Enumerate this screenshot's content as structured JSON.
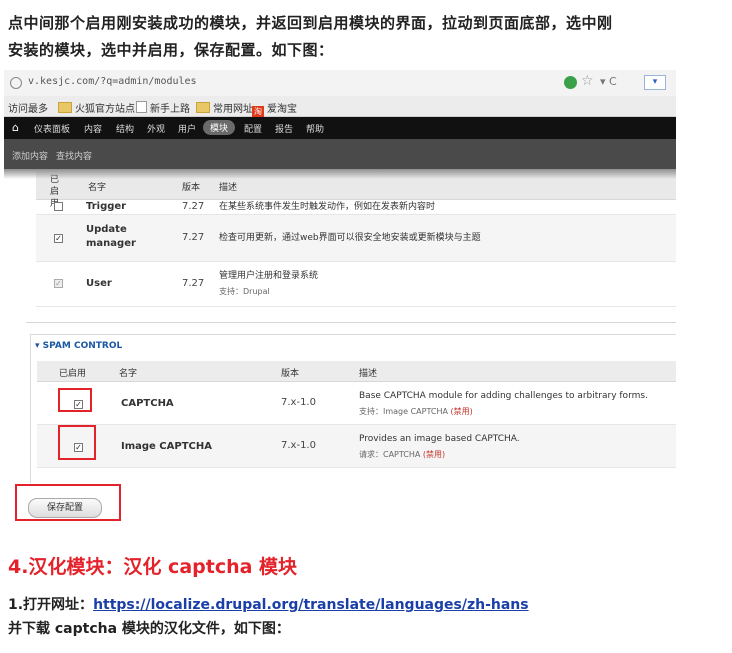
{
  "intro": {
    "line1": "点中间那个启用刚安装成功的模块，并返回到启用模块的界面，拉动到页面底部，选中刚",
    "line2": "安装的模块，选中并启用，保存配置。如下图："
  },
  "browser": {
    "url": "v.kesjc.com/?q=admin/modules",
    "bookmarks": [
      "访问最多",
      "火狐官方站点",
      "新手上路",
      "常用网址",
      "爱淘宝"
    ],
    "taobao_badge": "淘"
  },
  "admin_toolbar": {
    "items": [
      "仪表面板",
      "内容",
      "结构",
      "外观",
      "用户",
      "模块",
      "配置",
      "报告",
      "帮助"
    ],
    "active_index": 5,
    "shortcuts": [
      "添加内容",
      "查找内容"
    ]
  },
  "modules_table": {
    "headers": [
      "已启用",
      "名字",
      "版本",
      "描述"
    ],
    "rows": [
      {
        "name": "Trigger",
        "version": "7.27",
        "description": "在某些系统事件发生时触发动作，例如在发表新内容时",
        "checked": false,
        "disabled": false,
        "requires": ""
      },
      {
        "name": "Update manager",
        "version": "7.27",
        "description": "检查可用更新，通过web界面可以很安全地安装或更新模块与主题",
        "checked": true,
        "disabled": false,
        "requires": ""
      },
      {
        "name": "User",
        "version": "7.27",
        "description": "管理用户注册和登录系统",
        "checked": true,
        "disabled": true,
        "requires": "支持：Drupal"
      }
    ]
  },
  "spam_control": {
    "legend": "▾ SPAM CONTROL",
    "headers": [
      "已启用",
      "名字",
      "版本",
      "描述"
    ],
    "rows": [
      {
        "name": "CAPTCHA",
        "version": "7.x-1.0",
        "description": "Base CAPTCHA module for adding challenges to arbitrary forms.",
        "requires_prefix": "支持：",
        "requires_name": "Image CAPTCHA",
        "requires_status": "(禁用)",
        "checked": true
      },
      {
        "name": "Image CAPTCHA",
        "version": "7.x-1.0",
        "description": "Provides an image based CAPTCHA.",
        "requires_prefix": "请求：",
        "requires_name": "CAPTCHA",
        "requires_status": "(禁用)",
        "checked": true
      }
    ]
  },
  "save_button": "保存配置",
  "section_heading": "4.汉化模块：汉化 captcha 模块",
  "step1": {
    "prefix": "1.打开网址：",
    "link": "https://localize.drupal.org/translate/languages/zh-hans"
  },
  "step2": "并下载 captcha 模块的汉化文件，如下图：",
  "colors": {
    "highlight_red": "#e4222b",
    "link_blue": "#1a3fa8",
    "legend_blue": "#1c57a5"
  }
}
